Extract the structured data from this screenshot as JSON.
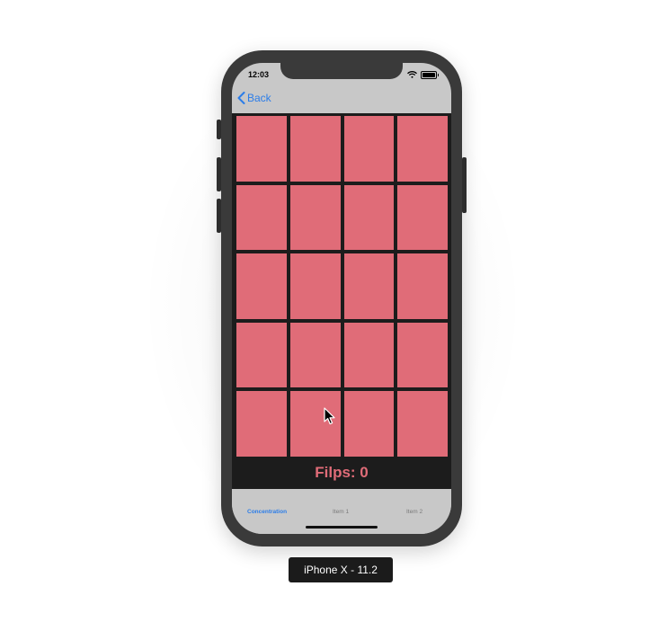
{
  "status_bar": {
    "time": "12:03"
  },
  "nav": {
    "back_label": "Back"
  },
  "game": {
    "card_color": "#e06c78",
    "rows": 5,
    "columns": 4,
    "flips_label": "Filps: 0"
  },
  "tab_bar": {
    "items": [
      {
        "label": "Concentration",
        "active": true
      },
      {
        "label": "Item 1",
        "active": false
      },
      {
        "label": "Item 2",
        "active": false
      }
    ]
  },
  "device_label": "iPhone X - 11.2"
}
